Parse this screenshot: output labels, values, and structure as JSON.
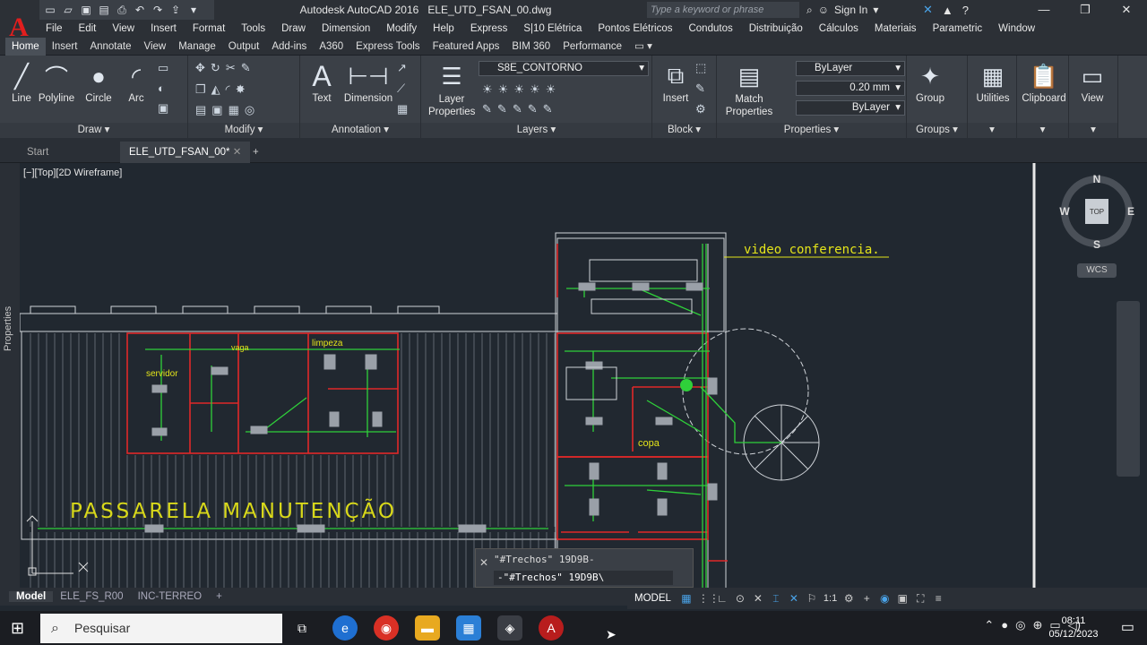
{
  "title": {
    "app": "Autodesk AutoCAD 2016",
    "file": "ELE_UTD_FSAN_00.dwg",
    "search_placeholder": "Type a keyword or phrase",
    "sign_in": "Sign In"
  },
  "menu": [
    "File",
    "Edit",
    "View",
    "Insert",
    "Format",
    "Tools",
    "Draw",
    "Dimension",
    "Modify",
    "Help",
    "Express",
    "S|10 Elétrica",
    "Pontos Elétricos",
    "Condutos",
    "Distribuição",
    "Cálculos",
    "Materiais",
    "Parametric",
    "Window"
  ],
  "ribbon_tabs": [
    "Home",
    "Insert",
    "Annotate",
    "View",
    "Manage",
    "Output",
    "Add-ins",
    "A360",
    "Express Tools",
    "Featured Apps",
    "BIM 360",
    "Performance"
  ],
  "panels": {
    "draw": {
      "title": "Draw",
      "line": "Line",
      "polyline": "Polyline",
      "circle": "Circle",
      "arc": "Arc"
    },
    "modify": {
      "title": "Modify"
    },
    "annotation": {
      "title": "Annotation",
      "text": "Text",
      "dimension": "Dimension"
    },
    "layers": {
      "title": "Layers",
      "layer_properties": "Layer Properties",
      "current_layer": "S8E_CONTORNO"
    },
    "block": {
      "title": "Block",
      "insert": "Insert"
    },
    "properties": {
      "title": "Properties",
      "match": "Match Properties",
      "color": "ByLayer",
      "lineweight": "0.20 mm",
      "linetype": "ByLayer"
    },
    "groups": {
      "title": "Groups",
      "group": "Group"
    },
    "utilities": "Utilities",
    "clipboard": "Clipboard",
    "view": "View"
  },
  "doc_tabs": {
    "start": "Start",
    "active": "ELE_UTD_FSAN_00*"
  },
  "viewport_label": "[−][Top][2D Wireframe]",
  "sidebar_label": "Properties",
  "viewcube": {
    "n": "N",
    "s": "S",
    "e": "E",
    "w": "W",
    "top": "TOP",
    "wcs": "WCS"
  },
  "drawing_text": {
    "video": "video conferencia.",
    "passarela": "PASSARELA MANUTENÇÃO",
    "vaga": "vaga",
    "limpeza": "limpeza",
    "servidor": "servidor",
    "copa": "copa"
  },
  "command": {
    "history": "\"#Trechos\" 19D9B-",
    "input": "-\"#Trechos\" 19D9B\\"
  },
  "layout_tabs": [
    "Model",
    "ELE_FS_R00",
    "INC-TERREO"
  ],
  "status": {
    "model": "MODEL",
    "scale": "1:1"
  },
  "taskbar": {
    "search": "Pesquisar",
    "time": "08:11",
    "date": "05/12/2023"
  }
}
